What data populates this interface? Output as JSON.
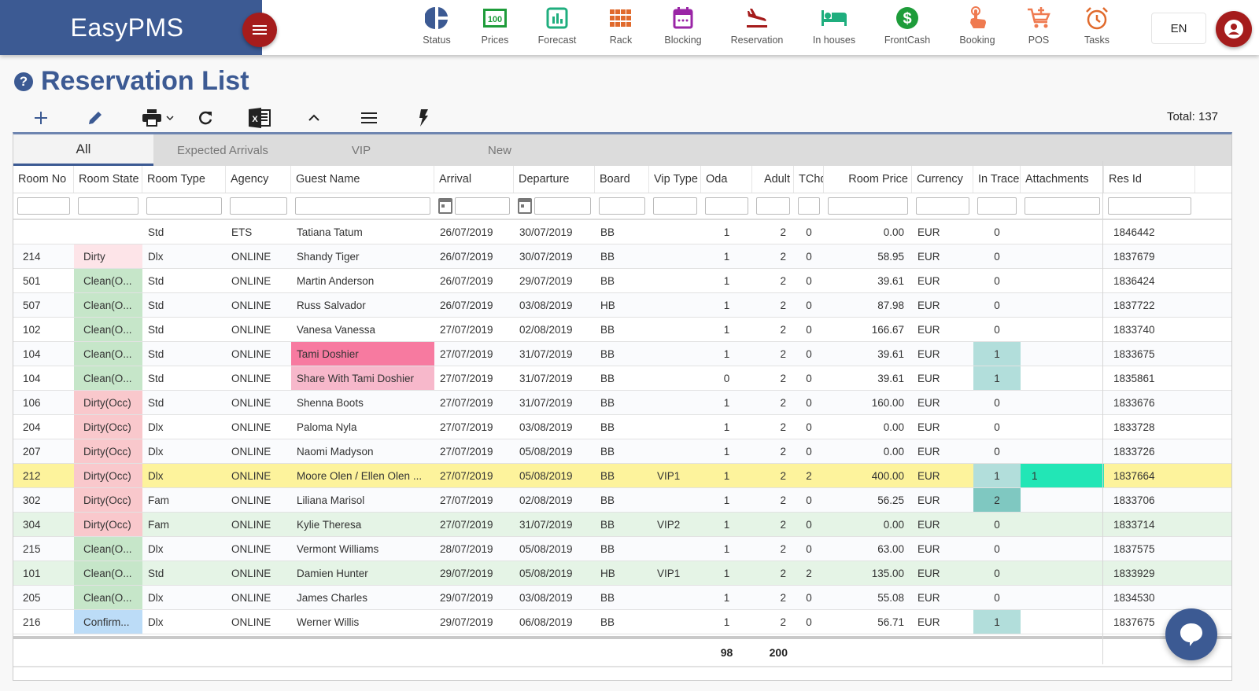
{
  "app": {
    "brand": "EasyPMS"
  },
  "nav": [
    {
      "label": "Status",
      "icon": "status-pie-icon",
      "color": "#3c5a93"
    },
    {
      "label": "Prices",
      "icon": "prices-icon",
      "color": "#1e9c3a"
    },
    {
      "label": "Forecast",
      "icon": "forecast-chart-icon",
      "color": "#1fae7e"
    },
    {
      "label": "Rack",
      "icon": "rack-grid-icon",
      "color": "#e06a2c"
    },
    {
      "label": "Blocking",
      "icon": "blocking-calendar-icon",
      "color": "#9a25a6"
    },
    {
      "label": "Reservation",
      "icon": "reservation-plane-icon",
      "color": "#a51c1c"
    },
    {
      "label": "In houses",
      "icon": "in-houses-bed-icon",
      "color": "#1fae7e"
    },
    {
      "label": "FrontCash",
      "icon": "frontcash-dollar-icon",
      "color": "#1e9c3a"
    },
    {
      "label": "Booking",
      "icon": "booking-hand-icon",
      "color": "#ef7a50"
    },
    {
      "label": "POS",
      "icon": "pos-cart-icon",
      "color": "#ef7a50"
    },
    {
      "label": "Tasks",
      "icon": "tasks-alarm-icon",
      "color": "#e06a2c"
    }
  ],
  "lang": "EN",
  "page": {
    "title": "Reservation List",
    "total": "Total: 137"
  },
  "toolbar": [
    "add-icon",
    "edit-icon",
    "print-icon",
    "refresh-icon",
    "excel-icon",
    "collapse-icon",
    "menu-lines-icon",
    "flash-icon"
  ],
  "tabs": [
    "All",
    "Expected Arrivals",
    "VIP",
    "New"
  ],
  "columns": [
    "Room No",
    "Room State",
    "Room Type",
    "Agency",
    "Guest Name",
    "Arrival",
    "Departure",
    "Board",
    "Vip Type",
    "Oda",
    "Adult",
    "TChd",
    "Room Price",
    "Currency",
    "In Trace",
    "Attachments",
    "Res Id"
  ],
  "rows": [
    {
      "room": "",
      "state": "",
      "type": "Std",
      "agency": "ETS",
      "guest": "Tatiana Tatum",
      "arrival": "26/07/2019",
      "departure": "30/07/2019",
      "board": "BB",
      "vip": "",
      "oda": "1",
      "adult": "2",
      "tchd": "0",
      "price": "0.00",
      "currency": "EUR",
      "trace": "0",
      "attach": "",
      "resid": "1846442"
    },
    {
      "room": "214",
      "state": "Dirty",
      "type": "Dlx",
      "agency": "ONLINE",
      "guest": "Shandy Tiger",
      "arrival": "26/07/2019",
      "departure": "30/07/2019",
      "board": "BB",
      "vip": "",
      "oda": "1",
      "adult": "2",
      "tchd": "0",
      "price": "58.95",
      "currency": "EUR",
      "trace": "0",
      "attach": "",
      "resid": "1837679"
    },
    {
      "room": "501",
      "state": "Clean(O...",
      "type": "Std",
      "agency": "ONLINE",
      "guest": "Martin Anderson",
      "arrival": "26/07/2019",
      "departure": "29/07/2019",
      "board": "BB",
      "vip": "",
      "oda": "1",
      "adult": "2",
      "tchd": "0",
      "price": "39.61",
      "currency": "EUR",
      "trace": "0",
      "attach": "",
      "resid": "1836424"
    },
    {
      "room": "507",
      "state": "Clean(O...",
      "type": "Std",
      "agency": "ONLINE",
      "guest": "Russ Salvador",
      "arrival": "26/07/2019",
      "departure": "03/08/2019",
      "board": "HB",
      "vip": "",
      "oda": "1",
      "adult": "2",
      "tchd": "0",
      "price": "87.98",
      "currency": "EUR",
      "trace": "0",
      "attach": "",
      "resid": "1837722"
    },
    {
      "room": "102",
      "state": "Clean(O...",
      "type": "Std",
      "agency": "ONLINE",
      "guest": "Vanesa Vanessa",
      "arrival": "27/07/2019",
      "departure": "02/08/2019",
      "board": "BB",
      "vip": "",
      "oda": "1",
      "adult": "2",
      "tchd": "0",
      "price": "166.67",
      "currency": "EUR",
      "trace": "0",
      "attach": "",
      "resid": "1833740"
    },
    {
      "room": "104",
      "state": "Clean(O...",
      "type": "Std",
      "agency": "ONLINE",
      "guest": "Tami Doshier",
      "arrival": "27/07/2019",
      "departure": "31/07/2019",
      "board": "BB",
      "vip": "",
      "oda": "1",
      "adult": "2",
      "tchd": "0",
      "price": "39.61",
      "currency": "EUR",
      "trace": "1",
      "attach": "",
      "resid": "1833675"
    },
    {
      "room": "104",
      "state": "Clean(O...",
      "type": "Std",
      "agency": "ONLINE",
      "guest": "Share With Tami Doshier",
      "arrival": "27/07/2019",
      "departure": "31/07/2019",
      "board": "BB",
      "vip": "",
      "oda": "0",
      "adult": "2",
      "tchd": "0",
      "price": "39.61",
      "currency": "EUR",
      "trace": "1",
      "attach": "",
      "resid": "1835861"
    },
    {
      "room": "106",
      "state": "Dirty(Occ)",
      "type": "Std",
      "agency": "ONLINE",
      "guest": "Shenna Boots",
      "arrival": "27/07/2019",
      "departure": "31/07/2019",
      "board": "BB",
      "vip": "",
      "oda": "1",
      "adult": "2",
      "tchd": "0",
      "price": "160.00",
      "currency": "EUR",
      "trace": "0",
      "attach": "",
      "resid": "1833676"
    },
    {
      "room": "204",
      "state": "Dirty(Occ)",
      "type": "Dlx",
      "agency": "ONLINE",
      "guest": "Paloma Nyla",
      "arrival": "27/07/2019",
      "departure": "03/08/2019",
      "board": "BB",
      "vip": "",
      "oda": "1",
      "adult": "2",
      "tchd": "0",
      "price": "0.00",
      "currency": "EUR",
      "trace": "0",
      "attach": "",
      "resid": "1833728"
    },
    {
      "room": "207",
      "state": "Dirty(Occ)",
      "type": "Dlx",
      "agency": "ONLINE",
      "guest": "Naomi Madyson",
      "arrival": "27/07/2019",
      "departure": "05/08/2019",
      "board": "BB",
      "vip": "",
      "oda": "1",
      "adult": "2",
      "tchd": "0",
      "price": "0.00",
      "currency": "EUR",
      "trace": "0",
      "attach": "",
      "resid": "1833726"
    },
    {
      "room": "212",
      "state": "Dirty(Occ)",
      "type": "Dlx",
      "agency": "ONLINE",
      "guest": "Moore Olen / Ellen Olen ...",
      "arrival": "27/07/2019",
      "departure": "05/08/2019",
      "board": "BB",
      "vip": "VIP1",
      "oda": "1",
      "adult": "2",
      "tchd": "2",
      "price": "400.00",
      "currency": "EUR",
      "trace": "1",
      "attach": "1",
      "resid": "1837664"
    },
    {
      "room": "302",
      "state": "Dirty(Occ)",
      "type": "Fam",
      "agency": "ONLINE",
      "guest": "Liliana Marisol",
      "arrival": "27/07/2019",
      "departure": "02/08/2019",
      "board": "BB",
      "vip": "",
      "oda": "1",
      "adult": "2",
      "tchd": "0",
      "price": "56.25",
      "currency": "EUR",
      "trace": "2",
      "attach": "",
      "resid": "1833706"
    },
    {
      "room": "304",
      "state": "Dirty(Occ)",
      "type": "Fam",
      "agency": "ONLINE",
      "guest": "Kylie Theresa",
      "arrival": "27/07/2019",
      "departure": "31/07/2019",
      "board": "BB",
      "vip": "VIP2",
      "oda": "1",
      "adult": "2",
      "tchd": "0",
      "price": "0.00",
      "currency": "EUR",
      "trace": "0",
      "attach": "",
      "resid": "1833714"
    },
    {
      "room": "215",
      "state": "Clean(O...",
      "type": "Dlx",
      "agency": "ONLINE",
      "guest": "Vermont Williams",
      "arrival": "28/07/2019",
      "departure": "05/08/2019",
      "board": "BB",
      "vip": "",
      "oda": "1",
      "adult": "2",
      "tchd": "0",
      "price": "63.00",
      "currency": "EUR",
      "trace": "0",
      "attach": "",
      "resid": "1837575"
    },
    {
      "room": "101",
      "state": "Clean(O...",
      "type": "Std",
      "agency": "ONLINE",
      "guest": "Damien Hunter",
      "arrival": "29/07/2019",
      "departure": "05/08/2019",
      "board": "HB",
      "vip": "VIP1",
      "oda": "1",
      "adult": "2",
      "tchd": "2",
      "price": "135.00",
      "currency": "EUR",
      "trace": "0",
      "attach": "",
      "resid": "1833929"
    },
    {
      "room": "205",
      "state": "Clean(O...",
      "type": "Dlx",
      "agency": "ONLINE",
      "guest": "James Charles",
      "arrival": "29/07/2019",
      "departure": "03/08/2019",
      "board": "BB",
      "vip": "",
      "oda": "1",
      "adult": "2",
      "tchd": "0",
      "price": "55.08",
      "currency": "EUR",
      "trace": "0",
      "attach": "",
      "resid": "1834530"
    },
    {
      "room": "216",
      "state": "Confirm...",
      "type": "Dlx",
      "agency": "ONLINE",
      "guest": "Werner Willis",
      "arrival": "29/07/2019",
      "departure": "06/08/2019",
      "board": "BB",
      "vip": "",
      "oda": "1",
      "adult": "2",
      "tchd": "0",
      "price": "56.71",
      "currency": "EUR",
      "trace": "1",
      "attach": "",
      "resid": "1837675"
    }
  ],
  "totals": {
    "oda": "98",
    "adult": "200"
  },
  "colors": {
    "state_dirty": "#fde4e8",
    "state_dirty_occ": "#f9c8cc",
    "state_clean": "#c6e6c9",
    "state_confirm": "#bcdcf7",
    "guest_main": "#f77aa0",
    "guest_share": "#f7b8cb",
    "trace_1": "#b2dedb",
    "trace_2": "#7fc8c1",
    "attach": "#22e6b6",
    "vip1_row": "#fdf39c",
    "vip_green_row": "#e5f4e6"
  }
}
